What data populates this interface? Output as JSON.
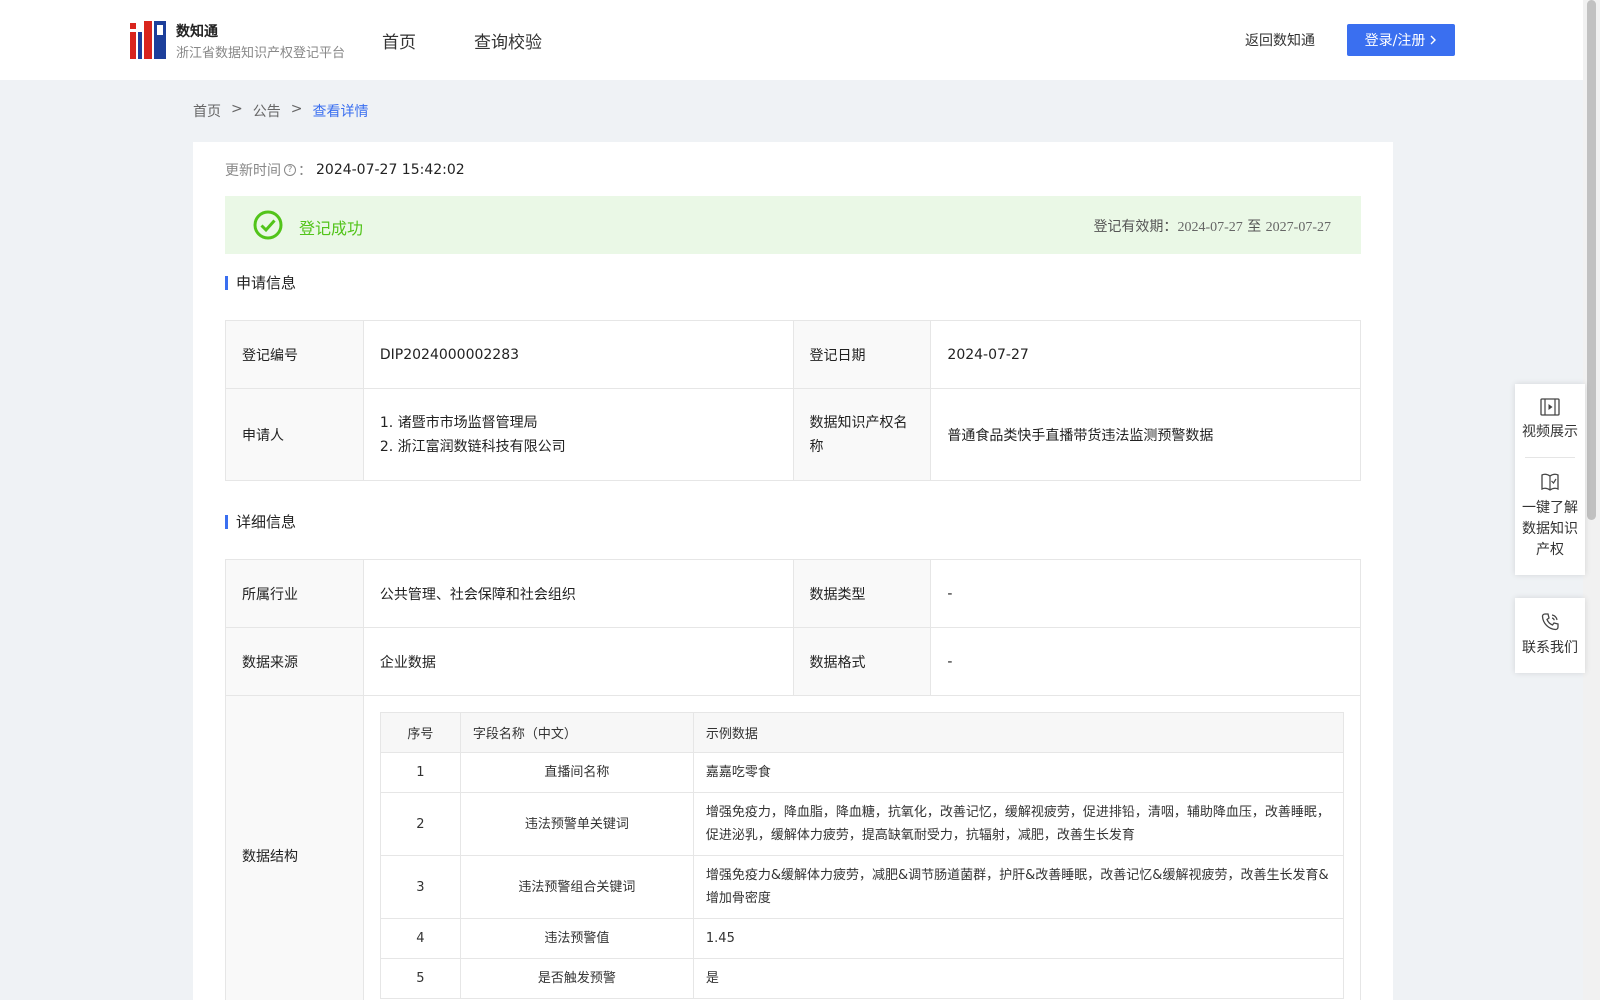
{
  "header": {
    "brand_name": "数知通",
    "brand_subtitle": "浙江省数据知识产权登记平台",
    "nav": [
      "首页",
      "查询校验"
    ],
    "return_link": "返回数知通",
    "login_label": "登录/注册"
  },
  "breadcrumb": {
    "items": [
      "首页",
      "公告",
      "查看详情"
    ],
    "separator": ">"
  },
  "update": {
    "label": "更新时间",
    "value": "2024-07-27 15:42:02"
  },
  "status": {
    "text": "登记成功",
    "validity_label": "登记有效期：",
    "validity_start": "2024-07-27",
    "validity_to": "至",
    "validity_end": "2027-07-27"
  },
  "application": {
    "title": "申请信息",
    "reg_no_label": "登记编号",
    "reg_no": "DIP2024000002283",
    "reg_date_label": "登记日期",
    "reg_date": "2024-07-27",
    "applicant_label": "申请人",
    "applicants": [
      "1. 诸暨市市场监督管理局",
      "2. 浙江富润数链科技有限公司"
    ],
    "ip_name_label": "数据知识产权名称",
    "ip_name": "普通食品类快手直播带货违法监测预警数据"
  },
  "detail": {
    "title": "详细信息",
    "industry_label": "所属行业",
    "industry": "公共管理、社会保障和社会组织",
    "data_type_label": "数据类型",
    "data_type": "-",
    "source_label": "数据来源",
    "source": "企业数据",
    "format_label": "数据格式",
    "format": "-",
    "structure_label": "数据结构",
    "structure": {
      "headers": [
        "序号",
        "字段名称（中文）",
        "示例数据"
      ],
      "rows": [
        [
          "1",
          "直播间名称",
          "嘉嘉吃零食"
        ],
        [
          "2",
          "违法预警单关键词",
          "增强免疫力，降血脂，降血糖，抗氧化，改善记忆，缓解视疲劳，促进排铅，清咽，辅助降血压，改善睡眠，促进泌乳，缓解体力疲劳，提高缺氧耐受力，抗辐射，减肥，改善生长发育"
        ],
        [
          "3",
          "违法预警组合关键词",
          "增强免疫力&缓解体力疲劳，减肥&调节肠道菌群，护肝&改善睡眠，改善记忆&缓解视疲劳，改善生长发育&增加骨密度"
        ],
        [
          "4",
          "违法预警值",
          "1.45"
        ],
        [
          "5",
          "是否触发预警",
          "是"
        ]
      ]
    }
  },
  "side_panel": {
    "video": "视频展示",
    "learn_lines": [
      "一键了解",
      "数据知识",
      "产权"
    ],
    "contact": "联系我们"
  },
  "colors": {
    "primary": "#3a6ff0",
    "success": "#52c41a",
    "success_bg": "#eaf8e6",
    "page_bg": "#eff2f5"
  }
}
